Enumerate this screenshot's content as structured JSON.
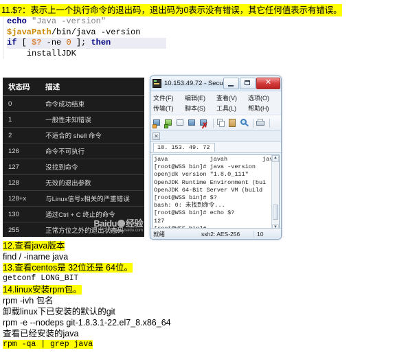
{
  "heading": {
    "text": "11.$?：表示上一个执行命令的退出码，退出码为0表示没有错误，其它任何值表示有错误。"
  },
  "code_block": {
    "lines": [
      {
        "tokens": [
          {
            "t": "echo",
            "c": "kw"
          },
          {
            "t": " ",
            "c": "plain"
          },
          {
            "t": "\"Java -version\"",
            "c": "str"
          }
        ]
      },
      {
        "tokens": [
          {
            "t": "$javaPath",
            "c": "var"
          },
          {
            "t": "/bin/java -version",
            "c": "plain"
          }
        ]
      },
      {
        "selected": true,
        "tokens": [
          {
            "t": "if",
            "c": "kw"
          },
          {
            "t": " [ ",
            "c": "plain"
          },
          {
            "t": "$?",
            "c": "hlvar"
          },
          {
            "t": " -ne ",
            "c": "plain"
          },
          {
            "t": "0",
            "c": "num"
          },
          {
            "t": " ]; ",
            "c": "plain"
          },
          {
            "t": "then",
            "c": "kw"
          }
        ]
      },
      {
        "tokens": [
          {
            "t": "    installJDK",
            "c": "plain"
          }
        ]
      }
    ]
  },
  "status_table": {
    "headers": [
      "状态码",
      "描述"
    ],
    "rows": [
      {
        "code": "0",
        "desc": "命令成功结束"
      },
      {
        "code": "1",
        "desc": "一般性未知错误"
      },
      {
        "code": "2",
        "desc": "不适合的 shell 命令"
      },
      {
        "code": "126",
        "desc": "命令不可执行"
      },
      {
        "code": "127",
        "desc": "没找到命令"
      },
      {
        "code": "128",
        "desc": "无效的退出参数"
      },
      {
        "code": "128+x",
        "desc": "与Linux信号x相关的严重错误"
      },
      {
        "code": "130",
        "desc": "通过Ctrl + C 终止的命令"
      },
      {
        "code": "255",
        "desc": "正常方位之外的退出状态码"
      }
    ],
    "watermark": {
      "main": "Baidu",
      "sub": "jingyan.baidu.com",
      "suffix": "经验"
    }
  },
  "crt_window": {
    "title": "10.153.49.72 - Secu...",
    "window_buttons": {
      "minimize": "",
      "maximize": "",
      "close": "✕"
    },
    "menu_row1": [
      "文件(F)",
      "编辑(E)",
      "查看(V)",
      "选项(O)"
    ],
    "menu_row2": [
      "传输(T)",
      "脚本(S)",
      "工具(L)",
      "帮助(H)"
    ],
    "tab_close_label": "✕",
    "session_tab": "10. 153. 49. 72",
    "screen_lines": [
      "java            javah          java",
      "[root@WSS bin]# java -version",
      "openjdk version \"1.8.0_111\"",
      "OpenJDK Runtime Environment (bui",
      "OpenJDK 64-Bit Server VM (build",
      "[root@WSS bin]# $?",
      "bash: 0: 未找到命令...",
      "[root@WSS bin]# echo $?",
      "127",
      "[root@WSS bin]#"
    ],
    "scroll_up": "▲",
    "scroll_down": "▼",
    "statusbar": {
      "ready": "就绪",
      "encryption": "ssh2: AES-256",
      "rows": "10"
    }
  },
  "notes": [
    {
      "text": "12.查看java版本",
      "highlight": true,
      "mono": false
    },
    {
      "text": "find / -iname java",
      "highlight": false,
      "mono": false
    },
    {
      "text": "13.查看centos是 32位还是 64位。",
      "highlight": true,
      "mono": false
    },
    {
      "text": "getconf LONG_BIT",
      "highlight": false,
      "mono": true
    },
    {
      "text": "14.linux安装rpm包。",
      "highlight": true,
      "mono": false
    },
    {
      "text": "rpm  -ivh   包名",
      "highlight": false,
      "mono": false
    },
    {
      "text": "卸载linux下已安装的默认的git",
      "highlight": false,
      "mono": false
    },
    {
      "text": "rpm  -e --nodeps  git-1.8.3.1-22.el7_8.x86_64",
      "highlight": false,
      "mono": false
    },
    {
      "text": "查看已经安装的java",
      "highlight": false,
      "mono": false
    },
    {
      "text": "rpm -qa  |  grep java",
      "highlight": true,
      "mono": true
    }
  ]
}
